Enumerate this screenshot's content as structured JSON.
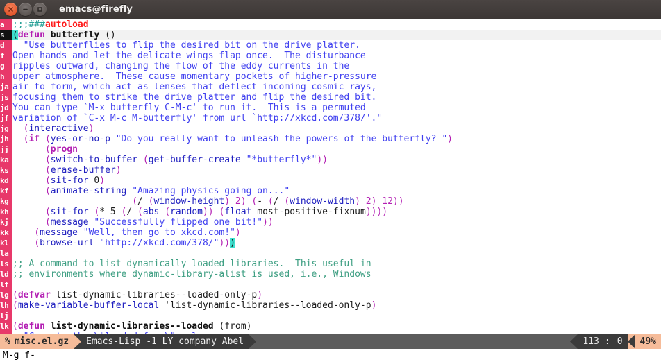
{
  "window": {
    "title": "emacs@firefly",
    "controls": [
      {
        "name": "close",
        "glyph": "×"
      },
      {
        "name": "minimize",
        "glyph": "−"
      },
      {
        "name": "maximize",
        "glyph": "□"
      }
    ]
  },
  "colors": {
    "avy_gutter_bg": "#e8386a",
    "avy_gutter_fg": "#ffffff",
    "cursor_highlight": "#3ee0cf",
    "modeline_accent": "#f6bc9a",
    "modeline_dark": "#3b3b3b",
    "modeline_grey": "#5c5c5c",
    "comment": "#3f9f83",
    "string": "#4040ef",
    "keyword": "#b31fb3",
    "warning": "#ff1a1a",
    "titlebar": "#3c3735"
  },
  "buffer": {
    "lines": [
      {
        "label": "a",
        "current": false,
        "tokens": [
          {
            "t": ";;;",
            "c": "s-cmtdelim"
          },
          {
            "t": "###",
            "c": "s-cmthash"
          },
          {
            "t": "autoload",
            "c": "s-warn"
          }
        ]
      },
      {
        "label": "s",
        "current": true,
        "labelStyle": "dark",
        "tokens": [
          {
            "t": "(",
            "c": "s-hl"
          },
          {
            "t": "defun",
            "c": "s-kw"
          },
          {
            "t": " ",
            "c": "s-plain"
          },
          {
            "t": "butterfly",
            "c": "s-fname"
          },
          {
            "t": " ",
            "c": "s-plain"
          },
          {
            "t": "()",
            "c": "s-plain"
          }
        ]
      },
      {
        "label": "d",
        "current": false,
        "tokens": [
          {
            "t": "  \"Use butterflies to flip the desired bit on the drive platter.",
            "c": "s-doc"
          }
        ]
      },
      {
        "label": "f",
        "current": false,
        "tokens": [
          {
            "t": "Open hands and let the delicate wings flap once.  The disturbance",
            "c": "s-doc"
          }
        ]
      },
      {
        "label": "g",
        "current": false,
        "tokens": [
          {
            "t": "ripples outward, changing the flow of the eddy currents in the",
            "c": "s-doc"
          }
        ]
      },
      {
        "label": "h",
        "current": false,
        "tokens": [
          {
            "t": "upper atmosphere.  These cause momentary pockets of higher-pressure",
            "c": "s-doc"
          }
        ]
      },
      {
        "label": "ja",
        "current": false,
        "tokens": [
          {
            "t": "air to form, which act as lenses that deflect incoming cosmic rays,",
            "c": "s-doc"
          }
        ]
      },
      {
        "label": "js",
        "current": false,
        "tokens": [
          {
            "t": "focusing them to strike the drive platter and flip the desired bit.",
            "c": "s-doc"
          }
        ]
      },
      {
        "label": "jd",
        "current": false,
        "tokens": [
          {
            "t": "You can type `M-x butterfly C-M-c' to run it.  This is a permuted",
            "c": "s-doc"
          }
        ]
      },
      {
        "label": "jf",
        "current": false,
        "tokens": [
          {
            "t": "variation of `C-x M-c M-butterfly' from url `http://xkcd.com/378/'.\"",
            "c": "s-doc"
          }
        ]
      },
      {
        "label": "jg",
        "current": false,
        "tokens": [
          {
            "t": "  ",
            "c": "s-plain"
          },
          {
            "t": "(",
            "c": "s-paren"
          },
          {
            "t": "interactive",
            "c": "s-func"
          },
          {
            "t": ")",
            "c": "s-paren"
          }
        ]
      },
      {
        "label": "jh",
        "current": false,
        "tokens": [
          {
            "t": "  ",
            "c": "s-plain"
          },
          {
            "t": "(",
            "c": "s-paren"
          },
          {
            "t": "if",
            "c": "s-kw"
          },
          {
            "t": " ",
            "c": "s-plain"
          },
          {
            "t": "(",
            "c": "s-paren"
          },
          {
            "t": "yes-or-no-p",
            "c": "s-func"
          },
          {
            "t": " ",
            "c": "s-plain"
          },
          {
            "t": "\"Do you really want to unleash the powers of the butterfly? \"",
            "c": "s-string"
          },
          {
            "t": ")",
            "c": "s-paren"
          }
        ]
      },
      {
        "label": "jj",
        "current": false,
        "tokens": [
          {
            "t": "      ",
            "c": "s-plain"
          },
          {
            "t": "(",
            "c": "s-paren"
          },
          {
            "t": "progn",
            "c": "s-kw"
          }
        ]
      },
      {
        "label": "ka",
        "current": false,
        "tokens": [
          {
            "t": "      ",
            "c": "s-plain"
          },
          {
            "t": "(",
            "c": "s-paren"
          },
          {
            "t": "switch-to-buffer",
            "c": "s-func"
          },
          {
            "t": " ",
            "c": "s-plain"
          },
          {
            "t": "(",
            "c": "s-paren"
          },
          {
            "t": "get-buffer-create",
            "c": "s-func"
          },
          {
            "t": " ",
            "c": "s-plain"
          },
          {
            "t": "\"*butterfly*\"",
            "c": "s-string"
          },
          {
            "t": "))",
            "c": "s-paren"
          }
        ]
      },
      {
        "label": "ks",
        "current": false,
        "tokens": [
          {
            "t": "      ",
            "c": "s-plain"
          },
          {
            "t": "(",
            "c": "s-paren"
          },
          {
            "t": "erase-buffer",
            "c": "s-func"
          },
          {
            "t": ")",
            "c": "s-paren"
          }
        ]
      },
      {
        "label": "kd",
        "current": false,
        "tokens": [
          {
            "t": "      ",
            "c": "s-plain"
          },
          {
            "t": "(",
            "c": "s-paren"
          },
          {
            "t": "sit-for",
            "c": "s-func"
          },
          {
            "t": " 0",
            "c": "s-plain"
          },
          {
            "t": ")",
            "c": "s-paren"
          }
        ]
      },
      {
        "label": "kf",
        "current": false,
        "tokens": [
          {
            "t": "      ",
            "c": "s-plain"
          },
          {
            "t": "(",
            "c": "s-paren"
          },
          {
            "t": "animate-string",
            "c": "s-func"
          },
          {
            "t": " ",
            "c": "s-plain"
          },
          {
            "t": "\"Amazing physics going on...\"",
            "c": "s-string"
          }
        ]
      },
      {
        "label": "kg",
        "current": false,
        "tokens": [
          {
            "t": "                      ",
            "c": "s-plain"
          },
          {
            "t": "(",
            "c": "s-paren"
          },
          {
            "t": "/ ",
            "c": "s-plain"
          },
          {
            "t": "(",
            "c": "s-paren"
          },
          {
            "t": "window-height",
            "c": "s-func"
          },
          {
            "t": ") 2) ",
            "c": "s-paren"
          },
          {
            "t": "(",
            "c": "s-paren"
          },
          {
            "t": "- ",
            "c": "s-plain"
          },
          {
            "t": "(",
            "c": "s-paren"
          },
          {
            "t": "/ ",
            "c": "s-plain"
          },
          {
            "t": "(",
            "c": "s-paren"
          },
          {
            "t": "window-width",
            "c": "s-func"
          },
          {
            "t": ") 2) 12))",
            "c": "s-paren"
          }
        ]
      },
      {
        "label": "kh",
        "current": false,
        "tokens": [
          {
            "t": "      ",
            "c": "s-plain"
          },
          {
            "t": "(",
            "c": "s-paren"
          },
          {
            "t": "sit-for",
            "c": "s-func"
          },
          {
            "t": " ",
            "c": "s-plain"
          },
          {
            "t": "(",
            "c": "s-paren"
          },
          {
            "t": "* 5 ",
            "c": "s-plain"
          },
          {
            "t": "(",
            "c": "s-paren"
          },
          {
            "t": "/ ",
            "c": "s-plain"
          },
          {
            "t": "(",
            "c": "s-paren"
          },
          {
            "t": "abs ",
            "c": "s-func"
          },
          {
            "t": "(",
            "c": "s-paren"
          },
          {
            "t": "random",
            "c": "s-func"
          },
          {
            "t": ")) ",
            "c": "s-paren"
          },
          {
            "t": "(",
            "c": "s-paren"
          },
          {
            "t": "float",
            "c": "s-func"
          },
          {
            "t": " most-positive-fixnum",
            "c": "s-plain"
          },
          {
            "t": "))))",
            "c": "s-paren"
          }
        ]
      },
      {
        "label": "kj",
        "current": false,
        "tokens": [
          {
            "t": "      ",
            "c": "s-plain"
          },
          {
            "t": "(",
            "c": "s-paren"
          },
          {
            "t": "message",
            "c": "s-func"
          },
          {
            "t": " ",
            "c": "s-plain"
          },
          {
            "t": "\"Successfully flipped one bit!\"",
            "c": "s-string"
          },
          {
            "t": "))",
            "c": "s-paren"
          }
        ]
      },
      {
        "label": "kk",
        "current": false,
        "tokens": [
          {
            "t": "    ",
            "c": "s-plain"
          },
          {
            "t": "(",
            "c": "s-paren"
          },
          {
            "t": "message",
            "c": "s-func"
          },
          {
            "t": " ",
            "c": "s-plain"
          },
          {
            "t": "\"Well, then go to xkcd.com!\"",
            "c": "s-string"
          },
          {
            "t": ")",
            "c": "s-paren"
          }
        ]
      },
      {
        "label": "kl",
        "current": false,
        "tokens": [
          {
            "t": "    ",
            "c": "s-plain"
          },
          {
            "t": "(",
            "c": "s-paren"
          },
          {
            "t": "browse-url",
            "c": "s-func"
          },
          {
            "t": " ",
            "c": "s-plain"
          },
          {
            "t": "\"http://xkcd.com/378/\"",
            "c": "s-string"
          },
          {
            "t": "))",
            "c": "s-paren"
          },
          {
            "t": ")",
            "c": "s-hl"
          }
        ]
      },
      {
        "label": "la",
        "current": false,
        "tokens": []
      },
      {
        "label": "ls",
        "current": false,
        "tokens": [
          {
            "t": ";; A command to list dynamically loaded libraries.  This useful in",
            "c": "s-comment"
          }
        ]
      },
      {
        "label": "ld",
        "current": false,
        "tokens": [
          {
            "t": ";; environments where dynamic-library-alist is used, i.e., Windows",
            "c": "s-comment"
          }
        ]
      },
      {
        "label": "lf",
        "current": false,
        "tokens": []
      },
      {
        "label": "lg",
        "current": false,
        "tokens": [
          {
            "t": "(",
            "c": "s-paren"
          },
          {
            "t": "defvar",
            "c": "s-kw"
          },
          {
            "t": " list-dynamic-libraries--loaded-only-p",
            "c": "s-plain"
          },
          {
            "t": ")",
            "c": "s-paren"
          }
        ]
      },
      {
        "label": "lh",
        "current": false,
        "tokens": [
          {
            "t": "(",
            "c": "s-paren"
          },
          {
            "t": "make-variable-buffer-local",
            "c": "s-func"
          },
          {
            "t": " 'list-dynamic-libraries--loaded-only-p",
            "c": "s-plain"
          },
          {
            "t": ")",
            "c": "s-paren"
          }
        ]
      },
      {
        "label": "lj",
        "current": false,
        "tokens": []
      },
      {
        "label": "lk",
        "current": false,
        "tokens": [
          {
            "t": "(",
            "c": "s-paren"
          },
          {
            "t": "defun",
            "c": "s-kw"
          },
          {
            "t": " ",
            "c": "s-plain"
          },
          {
            "t": "list-dynamic-libraries--loaded",
            "c": "s-fname"
          },
          {
            "t": " ",
            "c": "s-plain"
          },
          {
            "t": "(from)",
            "c": "s-plain"
          }
        ]
      },
      {
        "label": "ll",
        "current": false,
        "clipped": true,
        "tokens": [
          {
            "t": "  \"Compute the \\\"loaded from\\\" column.",
            "c": "s-doc"
          }
        ]
      }
    ]
  },
  "modeline": {
    "mod_indicator": "%",
    "buffer_name": "misc.el.gz",
    "major_mode": "Emacs-Lisp -1 LY company Abel",
    "line_number": "113",
    "column_separator": ":",
    "column_number": "0",
    "position_percent": "49%"
  },
  "echo_area": {
    "text": "M-g f-"
  }
}
